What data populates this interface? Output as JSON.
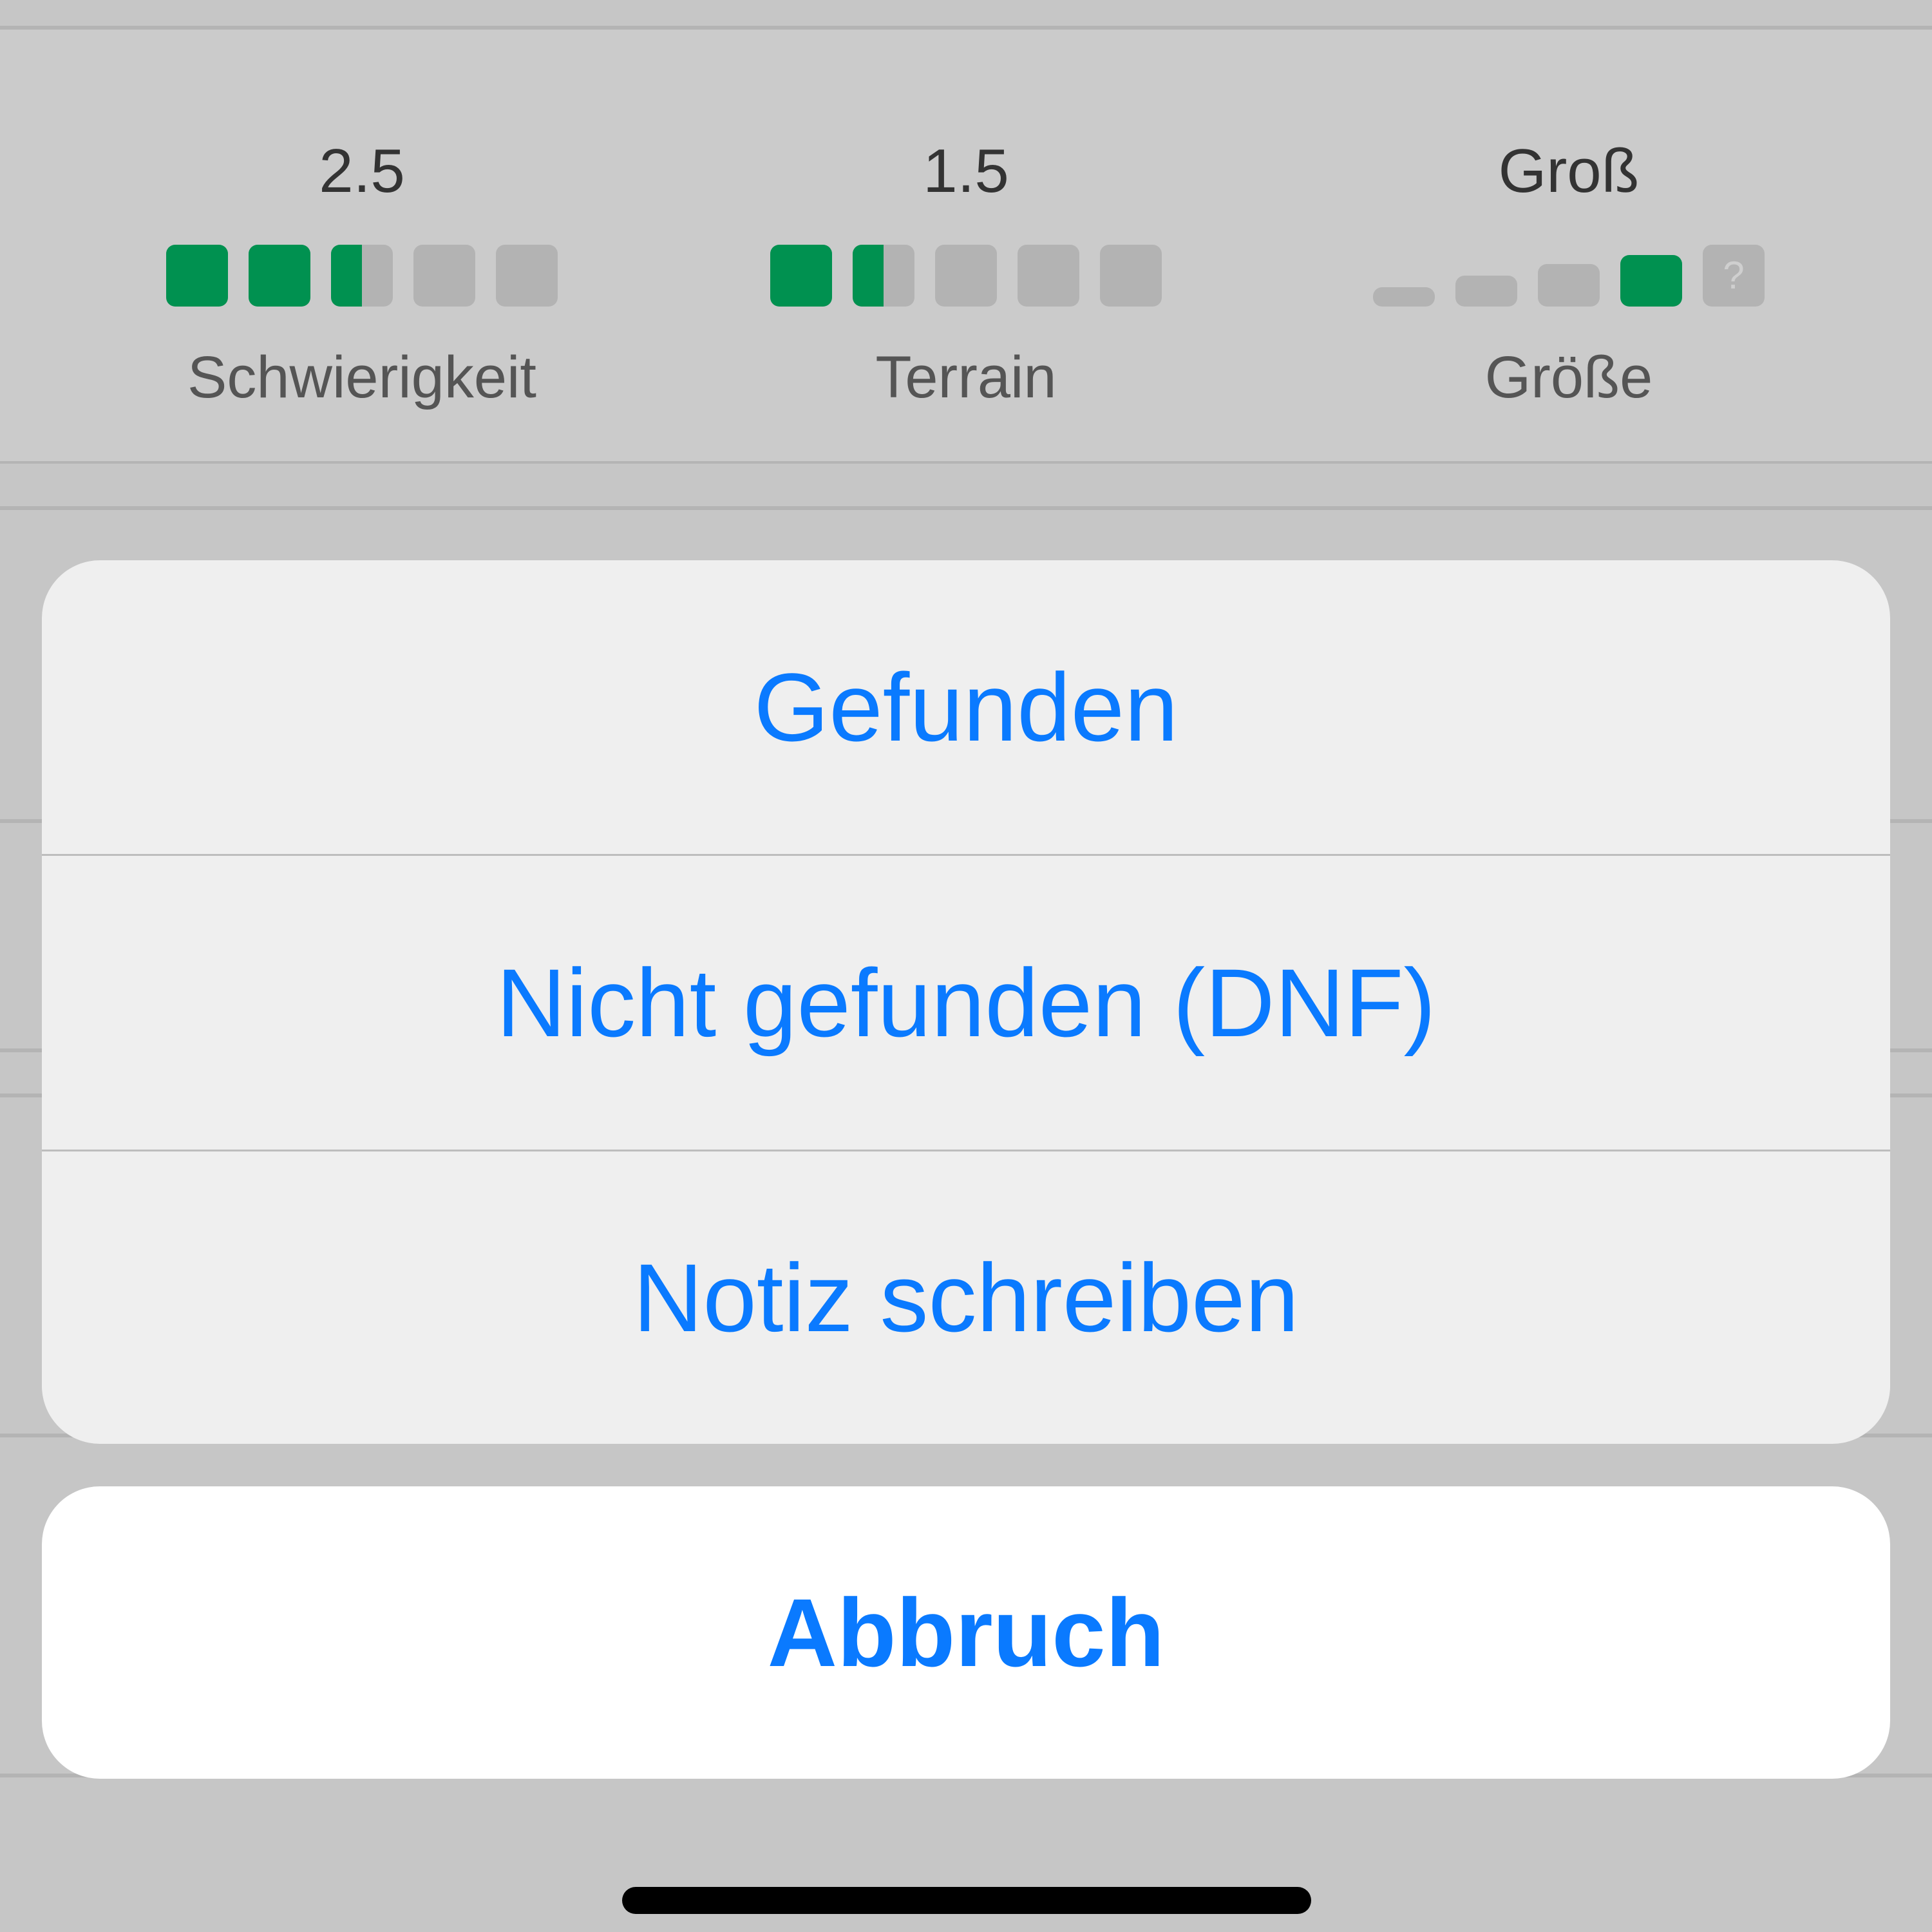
{
  "stats": [
    {
      "value": "2.5",
      "label": "Schwierigkeit",
      "rating": 2.5,
      "max": 5
    },
    {
      "value": "1.5",
      "label": "Terrain",
      "rating": 1.5,
      "max": 5
    },
    {
      "value": "Groß",
      "label": "Größe",
      "size_levels": 4,
      "selected_level": 4,
      "unknown_symbol": "?"
    }
  ],
  "action_sheet": {
    "actions": [
      "Gefunden",
      "Nicht gefunden (DNF)",
      "Notiz schreiben"
    ],
    "cancel_label": "Abbruch"
  },
  "colors": {
    "accent": "#0a7aff",
    "rating_fill": "#009150",
    "rating_empty": "#b3b3b3"
  }
}
